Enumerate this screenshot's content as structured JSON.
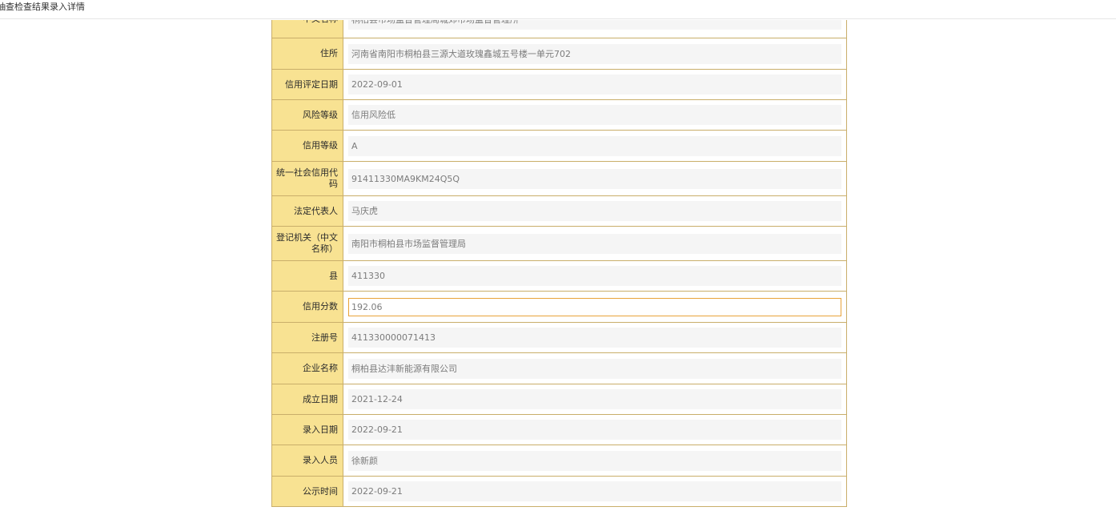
{
  "page": {
    "title": "抽查检查结果录入详情"
  },
  "rows": [
    {
      "label": "中文名称",
      "value": "桐柏县市场监督管理局城郊市场监督管理所"
    },
    {
      "label": "住所",
      "value": "河南省南阳市桐柏县三源大道玫瑰鑫城五号楼一单元702"
    },
    {
      "label": "信用评定日期",
      "value": "2022-09-01"
    },
    {
      "label": "风险等级",
      "value": "信用风险低"
    },
    {
      "label": "信用等级",
      "value": "A"
    },
    {
      "label": "统一社会信用代码",
      "value": "91411330MA9KM24Q5Q"
    },
    {
      "label": "法定代表人",
      "value": "马庆虎"
    },
    {
      "label": "登记机关（中文名称）",
      "value": "南阳市桐柏县市场监督管理局"
    },
    {
      "label": "县",
      "value": "411330"
    },
    {
      "label": "信用分数",
      "value": "192.06"
    },
    {
      "label": "注册号",
      "value": "411330000071413"
    },
    {
      "label": "企业名称",
      "value": "桐柏县达沣新能源有限公司"
    },
    {
      "label": "成立日期",
      "value": "2021-12-24"
    },
    {
      "label": "录入日期",
      "value": "2022-09-21"
    },
    {
      "label": "录入人员",
      "value": "徐新颜"
    },
    {
      "label": "公示时间",
      "value": "2022-09-21"
    }
  ]
}
